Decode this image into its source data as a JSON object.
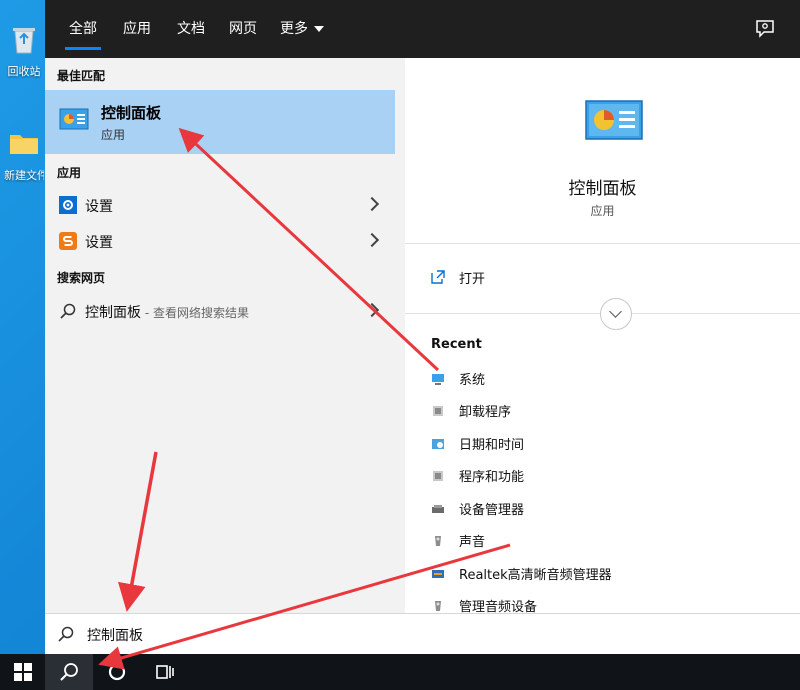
{
  "desktop": {
    "icons": [
      {
        "label": "回收站",
        "icon": "recycle-bin-icon"
      },
      {
        "label": "新建文件夹",
        "icon": "folder-icon"
      }
    ]
  },
  "tabs": [
    {
      "label": "全部",
      "active": true
    },
    {
      "label": "应用",
      "active": false
    },
    {
      "label": "文档",
      "active": false
    },
    {
      "label": "网页",
      "active": false
    },
    {
      "label": "更多",
      "active": false,
      "has_caret": true
    }
  ],
  "feedback_icon": "feedback-icon",
  "left": {
    "best_match_label": "最佳匹配",
    "best_match": {
      "title": "控制面板",
      "subtitle": "应用",
      "icon": "control-panel-icon"
    },
    "apps_label": "应用",
    "apps": [
      {
        "label": "设置",
        "icon": "gear-icon",
        "color": "#0a6fd1"
      },
      {
        "label": "设置",
        "icon": "sogou-s-icon",
        "color": "#f07a16"
      }
    ],
    "web_label": "搜索网页",
    "web_result": {
      "query": "控制面板",
      "suffix": " - 查看网络搜索结果",
      "icon": "search-icon"
    }
  },
  "right": {
    "title": "控制面板",
    "subtitle": "应用",
    "open_label": "打开",
    "recent_title": "Recent",
    "recent": [
      {
        "label": "系统"
      },
      {
        "label": "卸载程序"
      },
      {
        "label": "日期和时间"
      },
      {
        "label": "程序和功能"
      },
      {
        "label": "设备管理器"
      },
      {
        "label": "声音"
      },
      {
        "label": "Realtek高清晰音频管理器"
      },
      {
        "label": "管理音频设备"
      }
    ]
  },
  "search": {
    "value": "控制面板"
  },
  "colors": {
    "accent": "#0a84ff",
    "highlight": "#a9d1f3",
    "taskbar": "#101418",
    "annotation": "#e8383d"
  }
}
